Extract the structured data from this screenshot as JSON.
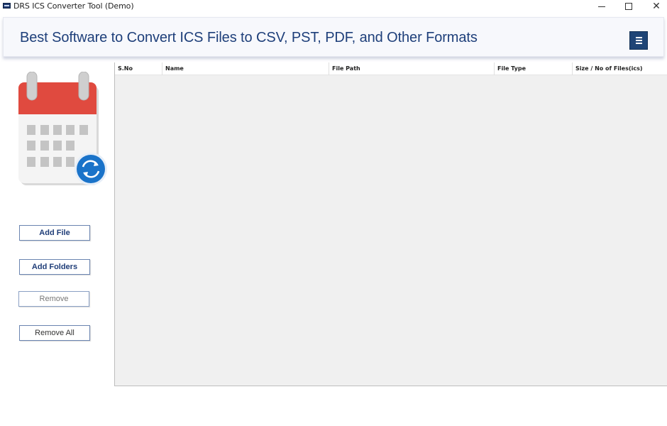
{
  "window": {
    "title": "DRS ICS Converter Tool (Demo)",
    "minimize_glyph": "",
    "close_glyph": "✕"
  },
  "banner": {
    "title": "Best Software to Convert ICS Files to CSV, PST, PDF, and Other Formats",
    "menu_icon": "hamburger-menu-icon"
  },
  "sidebar": {
    "logo_icon": "calendar-sync-icon",
    "buttons": {
      "add_file": "Add File",
      "add_folders": "Add Folders",
      "remove": "Remove",
      "remove_all": "Remove All"
    }
  },
  "grid": {
    "columns": [
      "S.No",
      "Name",
      "File Path",
      "File Type",
      "Size  /  No of Files(ics)"
    ],
    "rows": []
  },
  "colors": {
    "title_blue": "#1e3f7a",
    "menu_button": "#1f4576",
    "calendar_red": "#e04a3f",
    "sync_blue": "#1a73c9",
    "grid_bg": "#f0f0f0"
  }
}
